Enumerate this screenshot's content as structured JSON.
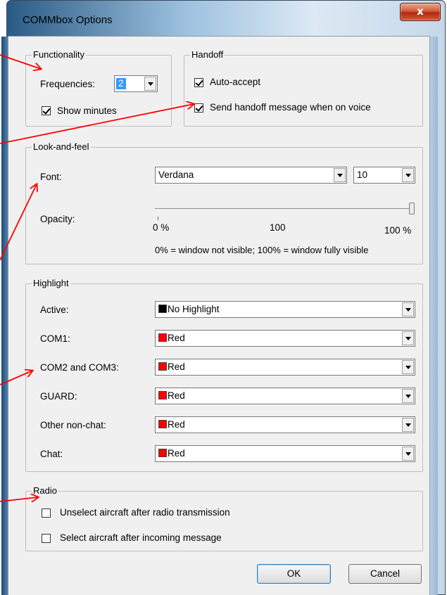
{
  "window": {
    "title": "COMMbox Options",
    "close_glyph": "x"
  },
  "functionality": {
    "title": "Functionality",
    "frequencies_label": "Frequencies:",
    "frequencies_value": "2",
    "show_minutes_label": "Show minutes",
    "show_minutes_checked": true
  },
  "handoff": {
    "title": "Handoff",
    "auto_accept_label": "Auto-accept",
    "auto_accept_checked": true,
    "send_message_label": "Send handoff message when on voice",
    "send_message_checked": true
  },
  "look": {
    "title": "Look-and-feel",
    "font_label": "Font:",
    "font_value": "Verdana",
    "size_value": "10",
    "opacity_label": "Opacity:",
    "opacity_value_percent": 100,
    "tick_0": "0 %",
    "tick_100": "100",
    "tick_100pct": "100 %",
    "note": "0% = window not visible; 100% = window fully visible"
  },
  "highlight": {
    "title": "Highlight",
    "rows": [
      {
        "label": "Active:",
        "value": "No Highlight",
        "swatch": "#000000"
      },
      {
        "label": "COM1:",
        "value": "Red",
        "swatch": "#ff0000"
      },
      {
        "label": "COM2 and COM3:",
        "value": "Red",
        "swatch": "#ff0000"
      },
      {
        "label": "GUARD:",
        "value": "Red",
        "swatch": "#ff0000"
      },
      {
        "label": "Other non-chat:",
        "value": "Red",
        "swatch": "#ff0000"
      },
      {
        "label": "Chat:",
        "value": "Red",
        "swatch": "#ff0000"
      }
    ]
  },
  "radio": {
    "title": "Radio",
    "unselect_label": "Unselect aircraft after radio transmission",
    "unselect_checked": false,
    "select_label": "Select aircraft after incoming message",
    "select_checked": false
  },
  "buttons": {
    "ok": "OK",
    "cancel": "Cancel"
  },
  "colors": {
    "annotation_arrow": "#ff0000"
  }
}
